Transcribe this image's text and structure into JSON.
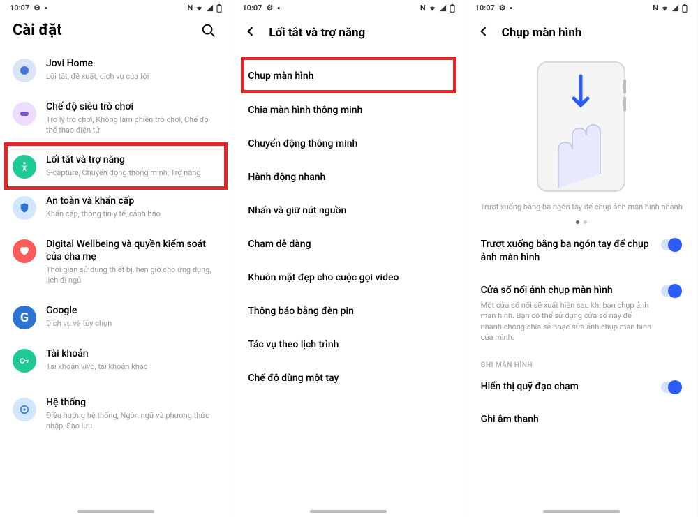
{
  "status": {
    "time": "10:07",
    "indicators": "N ⋮ 🏠 ⬡"
  },
  "screen1": {
    "title": "Cài đặt",
    "items": [
      {
        "title": "Jovi Home",
        "sub": "Lối tắt, đề xuất, dịch vụ của tôi",
        "color": "#dbe4f4",
        "inner": "#4a77d8"
      },
      {
        "title": "Chế độ siêu trò chơi",
        "sub": "Trợ lý trò chơi, Không làm phiền trò chơi, Chế độ thể thao điện tử",
        "color": "#ecdcff",
        "inner": "#7a52c9"
      },
      {
        "title": "Lối tắt và trợ năng",
        "sub": "S-capture, Chuyển động thông minh, Trợ năng",
        "color": "#1ec995",
        "inner": "#fff",
        "hl": true
      },
      {
        "title": "An toàn và khẩn cấp",
        "sub": "Khẩn cấp, thông tin y tế, cảnh báo",
        "color": "#d1e6ff",
        "inner": "#2d73d1"
      },
      {
        "title": "Digital Wellbeing và quyền kiểm soát của cha mẹ",
        "sub": "Thời gian sử dụng thiết bị, hẹn giờ cho ứng dụng, lịch đi ngủ",
        "color": "#ff5b5b",
        "inner": "#fff"
      },
      {
        "title": "Google",
        "sub": "Dịch vụ và tùy chọn",
        "color": "#2d73d1",
        "inner": "#fff"
      },
      {
        "title": "Tài khoản",
        "sub": "Tài khoản vivo, tài khoản khác",
        "color": "#1ec995",
        "inner": "#fff"
      },
      {
        "title": "Hệ thống",
        "sub": "Điều hướng hệ thống, Ngôn ngữ và phương thức nhập, Sao lưu",
        "color": "#d1e6ff",
        "inner": "#2d73d1"
      }
    ]
  },
  "screen2": {
    "title": "Lối tắt và trợ năng",
    "items": [
      {
        "title": "Chụp màn hình",
        "hl": true
      },
      {
        "title": "Chia màn hình thông minh"
      },
      {
        "title": "Chuyển động thông minh"
      },
      {
        "title": "Hành động nhanh"
      },
      {
        "title": "Nhấn và giữ nút nguồn"
      },
      {
        "title": "Chạm dễ dàng"
      },
      {
        "title": "Khuôn mặt đẹp cho cuộc gọi video"
      },
      {
        "title": "Thông báo bằng đèn pin"
      },
      {
        "title": "Tác vụ theo lịch trình"
      },
      {
        "title": "Chế độ dùng một tay"
      }
    ]
  },
  "screen3": {
    "title": "Chụp màn hình",
    "illus_text": "Trượt xuống bằng ba ngón tay để chụp ảnh màn hình nhanh",
    "toggles": [
      {
        "title": "Trượt xuống bằng ba ngón tay để chụp ảnh màn hình",
        "desc": ""
      },
      {
        "title": "Cửa sổ nổi ảnh chụp màn hình",
        "desc": "Một cửa sổ nổi sẽ xuất hiện sau khi bạn chụp ảnh màn hình. Bạn có thể sử dụng cửa sổ này để nhanh chóng chia sẻ hoặc sửa ảnh chụp màn hình của mình."
      }
    ],
    "section2": "GHI MÀN HÌNH",
    "toggles2": [
      {
        "title": "Hiển thị quỹ đạo chạm"
      },
      {
        "title": "Ghi âm thanh"
      }
    ]
  }
}
